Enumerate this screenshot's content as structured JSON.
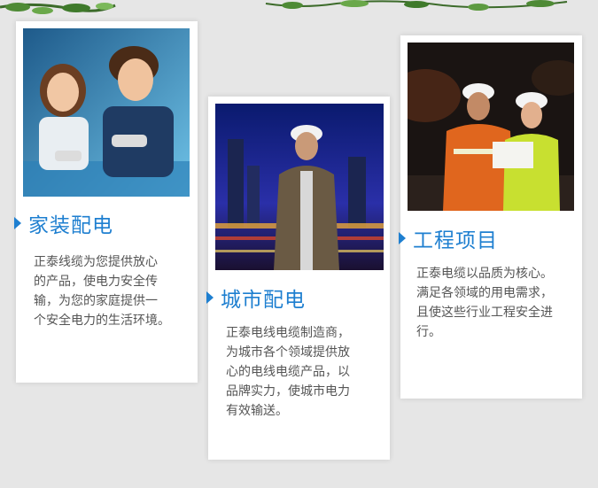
{
  "colors": {
    "accent": "#1e7fd0",
    "text": "#555555",
    "background": "#e6e6e6",
    "card": "#ffffff"
  },
  "cards": [
    {
      "title": "家装配电",
      "text": "正泰线缆为您提供放心\n的产品，使电力安全传\n输，为您的家庭提供一\n个安全电力的生活环境。"
    },
    {
      "title": "城市配电",
      "text": "正泰电线电缆制造商，\n为城市各个领域提供放\n心的电线电缆产品，以\n品牌实力，使城市电力\n有效输送。"
    },
    {
      "title": "工程项目",
      "text": "正泰电缆以品质为核心。\n满足各领域的用电需求，\n且使这些行业工程安全进\n行。"
    }
  ]
}
